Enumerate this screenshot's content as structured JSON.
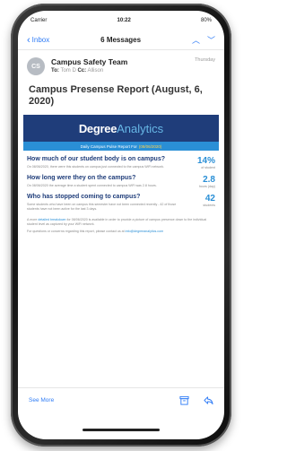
{
  "status": {
    "carrier": "Carrier",
    "time": "10:22",
    "battery": "80%"
  },
  "nav": {
    "back_label": "Inbox",
    "title": "6 Messages"
  },
  "sender": {
    "initials": "CS",
    "name": "Campus Safety Team",
    "date": "Thursday",
    "to_label": "To:",
    "to_name": "Tom D",
    "cc_label": "Cc:",
    "cc_name": "Allison"
  },
  "subject": "Campus Presense Report (August, 6, 2020)",
  "banner": {
    "brand_bold": "Degree",
    "brand_light": "Analytics",
    "pulse_label": "Daily Campus Pulse Report For",
    "pulse_date": "(08/06/2020)"
  },
  "sections": [
    {
      "heading": "How much of our student body is on campus?",
      "text": "On 08/06/2020, there were this students on campus just connected to the campus WiFi network.",
      "value": "14%",
      "unit": "of student"
    },
    {
      "heading": "How long were they on the campus?",
      "text": "On 08/06/2020 the average time a student spent connected to campus WiFi was 2.8 hours.",
      "value": "2.8",
      "unit": "hours (day)"
    },
    {
      "heading": "Who has stopped coming to campus?",
      "text": "Some students who have been on campus this semester have not been connected recently - 42 of those students have not been active for the last 3 days.",
      "value": "42",
      "unit": "students"
    }
  ],
  "footnote": {
    "line1_pre": "A more",
    "line1_link": "detailed breakdown",
    "line1_post": "for 08/06/2020 is available in order to provide a picture of campus presence down to the individual student level as captured by your WiFi network.",
    "line2_pre": "For questions or concerns regarding this report, please contact us at",
    "line2_link": "info@degreeanalytics.com"
  },
  "bottom": {
    "see_more": "See More"
  },
  "colors": {
    "accent": "#2f7cf6",
    "banner": "#1f3d7a",
    "pulse": "#2a8fd6"
  }
}
